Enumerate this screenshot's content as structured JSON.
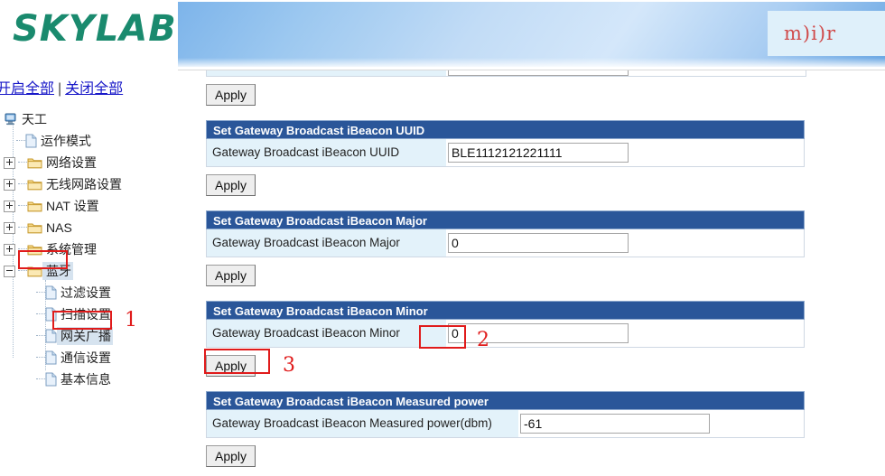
{
  "banner": {
    "logo_text": "SKYLAB",
    "badge_text": "m)i)r",
    "logo_color": "#1a8a6e"
  },
  "sidebar": {
    "expand_all_label": "开启全部",
    "separator": "|",
    "collapse_all_label": "关闭全部",
    "tree": {
      "root_label": "天工",
      "items": [
        {
          "label": "运作模式",
          "icon": "page-icon",
          "level": 1,
          "expander": "none"
        },
        {
          "label": "网络设置",
          "icon": "folder-icon",
          "level": 1,
          "expander": "plus"
        },
        {
          "label": "无线网路设置",
          "icon": "folder-icon",
          "level": 1,
          "expander": "plus"
        },
        {
          "label": "NAT 设置",
          "icon": "folder-icon",
          "level": 1,
          "expander": "plus"
        },
        {
          "label": "NAS",
          "icon": "folder-icon",
          "level": 1,
          "expander": "plus"
        },
        {
          "label": "系统管理",
          "icon": "folder-icon",
          "level": 1,
          "expander": "plus"
        },
        {
          "label": "蓝牙",
          "icon": "folder-icon",
          "level": 1,
          "expander": "minus",
          "highlighted_box": true
        },
        {
          "label": "过滤设置",
          "icon": "page-icon",
          "level": 2,
          "expander": "none"
        },
        {
          "label": "扫描设置",
          "icon": "page-icon",
          "level": 2,
          "expander": "none"
        },
        {
          "label": "网关广播",
          "icon": "page-icon",
          "level": 2,
          "expander": "none",
          "selected": true,
          "highlighted_box": true
        },
        {
          "label": "通信设置",
          "icon": "page-icon",
          "level": 2,
          "expander": "none"
        },
        {
          "label": "基本信息",
          "icon": "page-icon",
          "level": 2,
          "expander": "none"
        }
      ]
    }
  },
  "annotations": {
    "step1": "1",
    "step2": "2",
    "step3": "3",
    "color": "#e01b1b"
  },
  "main": {
    "top_apply_label": "Apply",
    "panels": [
      {
        "title": "Set Gateway Broadcast iBeacon UUID",
        "row_label": "Gateway Broadcast iBeacon UUID",
        "value": "BLE1112121221111",
        "apply_label": "Apply"
      },
      {
        "title": "Set Gateway Broadcast iBeacon Major",
        "row_label": "Gateway Broadcast iBeacon Major",
        "value": "0",
        "apply_label": "Apply"
      },
      {
        "title": "Set Gateway Broadcast iBeacon Minor",
        "row_label": "Gateway Broadcast iBeacon Minor",
        "value": "0",
        "apply_label": "Apply"
      },
      {
        "title": "Set Gateway Broadcast iBeacon Measured power",
        "row_label": "Gateway Broadcast iBeacon Measured power(dbm)",
        "value": "-61",
        "apply_label": "Apply"
      }
    ]
  },
  "colors": {
    "panel_header_blue": "#2a5699",
    "row_label_bg": "#e3f2fa",
    "link_blue": "#1818c8",
    "annotation_red": "#e01b1b"
  }
}
